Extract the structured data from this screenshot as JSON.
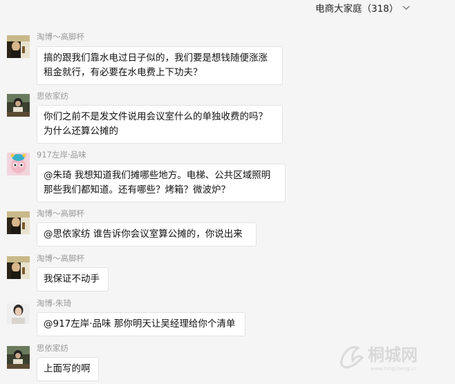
{
  "header": {
    "group_title": "电商大家庭（318）"
  },
  "messages": [
    {
      "sender": "淘博～高脚杯",
      "avatar": "avatar-gaojiaobei",
      "lines": [
        "搞的跟我们靠水电过日子似的，我们要是想钱随便涨涨",
        "租金就行，有必要在水电费上下功夫？"
      ]
    },
    {
      "sender": "思依家纺",
      "avatar": "avatar-siyijiafang",
      "lines": [
        "你们之前不是发文件说用会议室什么的单独收费的吗？",
        "为什么还算公摊的"
      ]
    },
    {
      "sender": "917左岸·品味",
      "avatar": "avatar-zuoan-pinwei",
      "lines": [
        "@朱琦 我想知道我们摊哪些地方。电梯、公共区域照明",
        "那些我们都知道。还有哪些？烤箱？微波炉？"
      ]
    },
    {
      "sender": "淘博～高脚杯",
      "avatar": "avatar-gaojiaobei",
      "lines": [
        "@思依家纺 谁告诉你会议室算公摊的，你说出来"
      ]
    },
    {
      "sender": "淘博～高脚杯",
      "avatar": "avatar-gaojiaobei",
      "lines": [
        "我保证不动手"
      ]
    },
    {
      "sender": "淘博-朱琦",
      "avatar": "avatar-zhuqi",
      "lines": [
        "@917左岸·品味 那你明天让吴经理给你个清单"
      ]
    },
    {
      "sender": "思依家纺",
      "avatar": "avatar-siyijiafang",
      "lines": [
        "上面写的啊"
      ]
    }
  ],
  "watermark": {
    "text": "桐城网",
    "url_text": "www.tongcheng.cc"
  }
}
